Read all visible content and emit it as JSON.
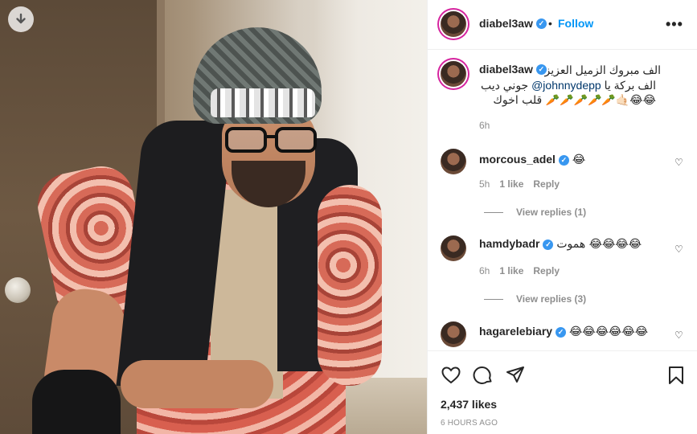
{
  "post": {
    "username": "diabel3aw",
    "follow_label": "Follow",
    "separator": "•",
    "caption_user": "diabel3aw",
    "caption_line1": "الف مبروك الزميل العزيز",
    "caption_line2_prefix": "الف بركة يا ",
    "caption_mention": "@johnnydepp",
    "caption_line2_suffix": " جوني ديب",
    "caption_line3": "😂😂🤙🏻🥕🥕🥕🥕🥕 قلب اخوك",
    "caption_time": "6h"
  },
  "comments": [
    {
      "username": "morcous_adel",
      "text": "😂",
      "time": "5h",
      "likes": "1 like",
      "reply": "Reply",
      "view_replies": "View replies (1)"
    },
    {
      "username": "hamdybadr",
      "text": "هموت 😂😂😂😂",
      "time": "6h",
      "likes": "1 like",
      "reply": "Reply",
      "view_replies": "View replies (3)"
    },
    {
      "username": "hagarelebiary",
      "text": "😂😂😂😂😂😂"
    }
  ],
  "footer": {
    "likes": "2,437 likes",
    "time_ago": "6 HOURS AGO"
  },
  "icons": {
    "download": "download-icon",
    "more": "more-options-icon",
    "heart": "heart-icon",
    "comment": "comment-icon",
    "share": "share-icon",
    "save": "bookmark-icon"
  },
  "colors": {
    "follow": "#0095f6",
    "verified": "#3897f0",
    "muted": "#8e8e8e"
  }
}
